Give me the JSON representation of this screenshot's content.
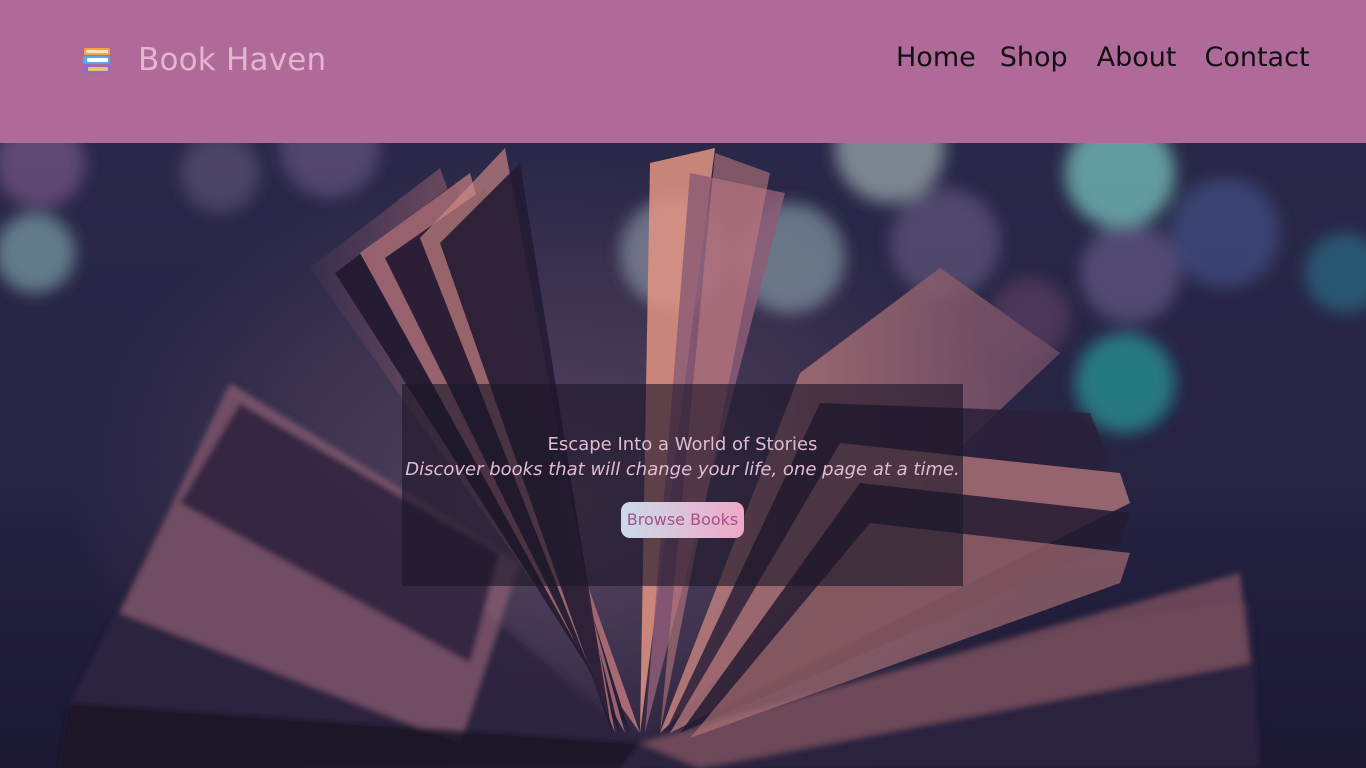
{
  "header": {
    "logo_icon": "stacked-books-icon",
    "brand": "Book Haven",
    "nav": [
      "Home",
      "Shop",
      "About",
      "Contact"
    ]
  },
  "hero": {
    "background_image": "open-book-bokeh-photo",
    "title": "Escape Into a World of Stories",
    "subtitle": "Discover books that will change your life, one page at a time.",
    "button_label": "Browse Books"
  },
  "colors": {
    "header_bg": "#b06a9a",
    "brand_text": "#e2b6cf",
    "nav_text": "#111111",
    "overlay_bg": "#1c1628",
    "hero_text": "#e0bcd2",
    "button_text": "#a3528a"
  }
}
